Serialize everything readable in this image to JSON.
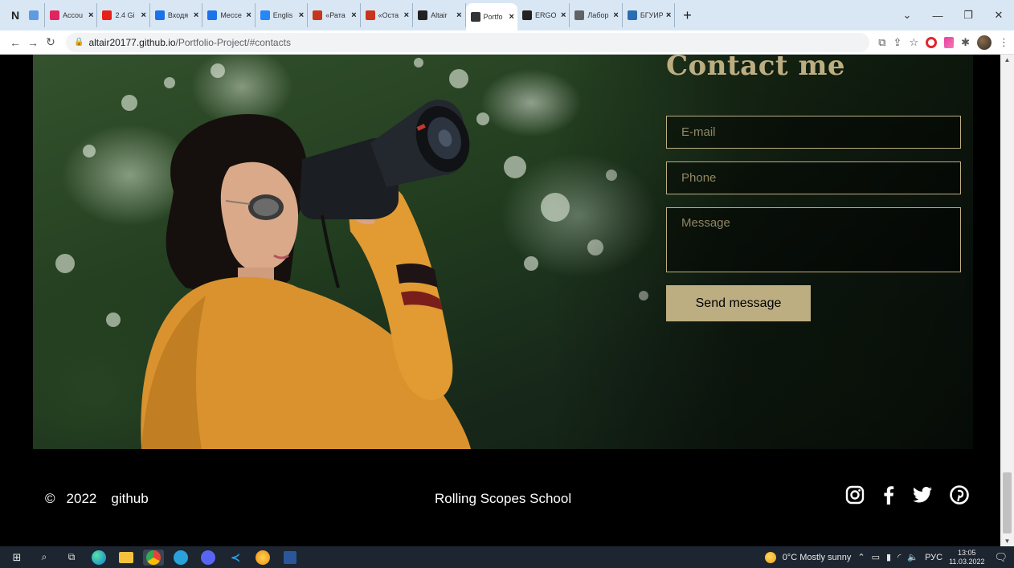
{
  "browser": {
    "pinned_tab": "N",
    "tabs": [
      {
        "label": "Accou",
        "fav": "#e0245e"
      },
      {
        "label": "2.4 Gi",
        "fav": "#e62117"
      },
      {
        "label": "Входя",
        "fav": "#1a73e8"
      },
      {
        "label": "Мессе",
        "fav": "#1a73e8"
      },
      {
        "label": "Englis",
        "fav": "#2787f5"
      },
      {
        "label": "«Рата",
        "fav": "#c7361a"
      },
      {
        "label": "«Оста",
        "fav": "#c7361a"
      },
      {
        "label": "Altair",
        "fav": "#222222"
      },
      {
        "label": "Portfo",
        "fav": "#333333"
      },
      {
        "label": "ERGO",
        "fav": "#222222"
      },
      {
        "label": "Лабор",
        "fav": "#5f6368"
      },
      {
        "label": "БГУИР",
        "fav": "#2a6db0"
      }
    ],
    "active_tab_index": 8,
    "url_host": "altair20177.github.io",
    "url_path": "/Portfolio-Project/#contacts"
  },
  "contacts": {
    "title": "Contact me",
    "email_placeholder": "E-mail",
    "phone_placeholder": "Phone",
    "message_placeholder": "Message",
    "send_label": "Send message"
  },
  "footer": {
    "copyright_symbol": "©",
    "year": "2022",
    "github_label": "github",
    "school_label": "Rolling Scopes School",
    "socials": [
      "instagram-icon",
      "facebook-icon",
      "twitter-icon",
      "pinterest-icon"
    ]
  },
  "taskbar": {
    "weather": "0°C  Mostly sunny",
    "language": "РУС",
    "time": "13:05",
    "date": "11.03.2022"
  },
  "colors": {
    "accent_gold": "#bdae82",
    "page_bg": "#000000",
    "taskbar_bg": "#1c2530"
  }
}
